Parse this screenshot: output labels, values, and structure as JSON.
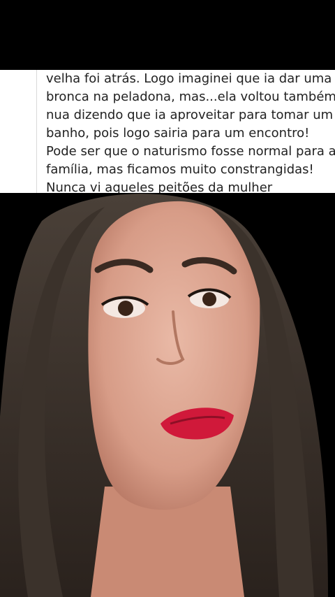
{
  "post": {
    "lines": [
      "velha foi atrás. Logo imaginei que ia dar uma",
      "bronca na peladona, mas...ela voltou também",
      "nua dizendo que ia aproveitar para tomar um",
      "banho, pois logo sairia para um encontro!",
      "Pode ser que o naturismo fosse normal para a",
      "família, mas ficamos muito constrangidas!",
      "Nunca vi aqueles peitões  da mulher"
    ]
  },
  "video": {
    "subject": "woman-speaking-to-camera"
  },
  "colors": {
    "background": "#000000",
    "card": "#ffffff",
    "text": "#222222",
    "lips": "#d0193a"
  }
}
